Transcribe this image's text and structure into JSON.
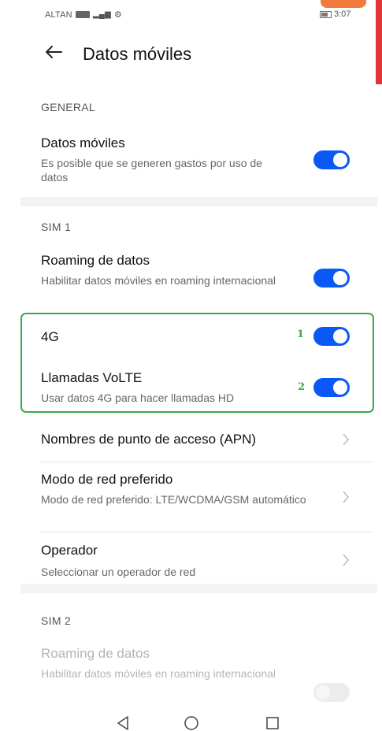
{
  "status_bar": {
    "carrier": "ALTAN",
    "time": "3:07"
  },
  "header": {
    "title": "Datos móviles"
  },
  "general": {
    "section_label": "GENERAL",
    "mobile_data": {
      "title": "Datos móviles",
      "subtitle": "Es posible que se generen gastos por uso de datos",
      "enabled": true
    }
  },
  "sim1": {
    "section_label": "SIM 1",
    "roaming": {
      "title": "Roaming de datos",
      "subtitle": "Habilitar datos móviles en roaming internacional",
      "enabled": true
    },
    "lte": {
      "title": "4G",
      "badge": "1",
      "enabled": true
    },
    "volte": {
      "title": "Llamadas VoLTE",
      "subtitle": "Usar datos 4G para hacer llamadas HD",
      "badge": "2",
      "enabled": true
    },
    "apn": {
      "title": "Nombres de punto de acceso (APN)"
    },
    "network_mode": {
      "title": "Modo de red preferido",
      "subtitle": "Modo de red preferido: LTE/WCDMA/GSM automático"
    },
    "operator": {
      "title": "Operador",
      "subtitle": "Seleccionar un operador de red"
    }
  },
  "sim2": {
    "section_label": "SIM 2",
    "roaming": {
      "title": "Roaming de datos",
      "subtitle": "Habilitar datos móviles en roaming internacional",
      "enabled": false,
      "disabled": true
    }
  },
  "colors": {
    "toggle_on": "#0a59f7",
    "highlight_border": "#3aa94c",
    "accent_red": "#e0353b",
    "accent_orange": "#f07b3c"
  },
  "icons": {
    "back": "arrow-left-icon",
    "chevron": "chevron-right-icon",
    "nav_back": "triangle-back-icon",
    "nav_home": "circle-home-icon",
    "nav_recent": "square-recent-icon"
  }
}
